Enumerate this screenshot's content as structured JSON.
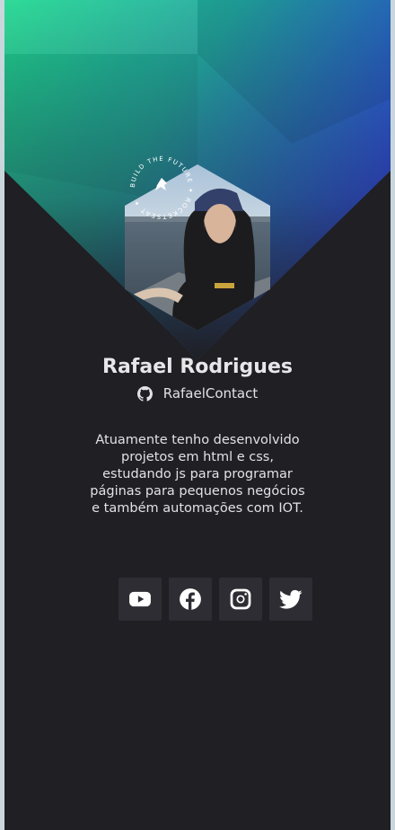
{
  "profile": {
    "name": "Rafael Rodrigues",
    "github_user": "RafaelContact",
    "bio": "Atuamente tenho desenvolvido projetos em html e css, estudando js para programar páginas para pequenos negócios e também automações com IOT.",
    "badge_text": "BUILD THE FUTURE • ROCKETSEAT"
  },
  "social": [
    {
      "name": "youtube",
      "icon": "youtube-icon"
    },
    {
      "name": "facebook",
      "icon": "facebook-icon"
    },
    {
      "name": "instagram",
      "icon": "instagram-icon"
    },
    {
      "name": "twitter",
      "icon": "twitter-icon"
    }
  ],
  "colors": {
    "background": "#1f1f24",
    "button_bg": "#2d2d33",
    "text": "#e1e1e6",
    "gradient_green": "#1fd890",
    "gradient_blue": "#2d4be0"
  }
}
